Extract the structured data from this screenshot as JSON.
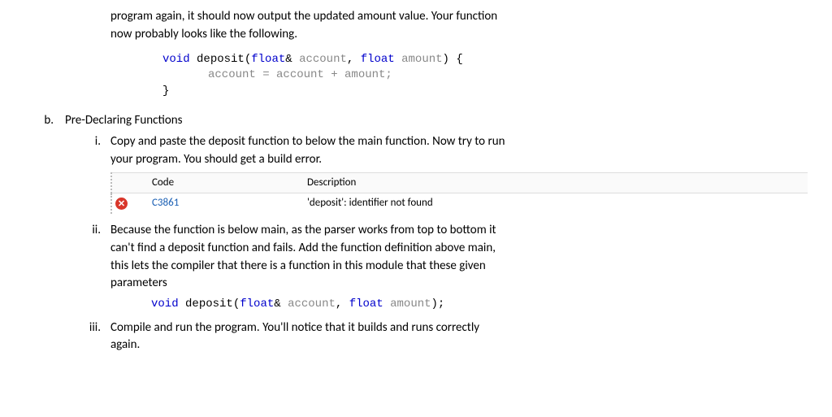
{
  "intro": {
    "line1": "program again, it should now output the updated amount value.  Your function",
    "line2": "now probably looks like the following."
  },
  "code1": {
    "l1_kw": "void",
    "l1_fn": " deposit(",
    "l1_t1": "float",
    "l1_p1": "& ",
    "l1_v1": "account",
    "l1_c1": ", ",
    "l1_t2": "float",
    "l1_sp": " ",
    "l1_v2": "amount",
    "l1_p2": ") {",
    "l2": "account = account + amount;",
    "l3": "}"
  },
  "section_b": {
    "label": "b.",
    "title": "Pre-Declaring Functions"
  },
  "item_i": {
    "label": "i.",
    "line1": "Copy and paste the deposit function to below the main function.  Now try to run",
    "line2": "your program.  You should get a build error.",
    "table": {
      "h_icon": "",
      "h_code": "Code",
      "h_desc": "Description",
      "code": "C3861",
      "desc": "'deposit': identifier not found"
    }
  },
  "item_ii": {
    "label": "ii.",
    "line1": "Because the function is below main, as the parser works from top to bottom it",
    "line2": "can't find a deposit function and fails.  Add the function definition above main,",
    "line3": "this lets the compiler that there is a function in this module that these given",
    "line4": "parameters",
    "code": {
      "kw": "void",
      "fn": " deposit(",
      "t1": "float",
      "p1": "& ",
      "v1": "account",
      "c1": ", ",
      "t2": "float",
      "sp": " ",
      "v2": "amount",
      "p2": ");"
    }
  },
  "item_iii": {
    "label": "iii.",
    "line1": "Compile and run the program.   You'll notice that it builds and runs correctly",
    "line2": "again."
  }
}
